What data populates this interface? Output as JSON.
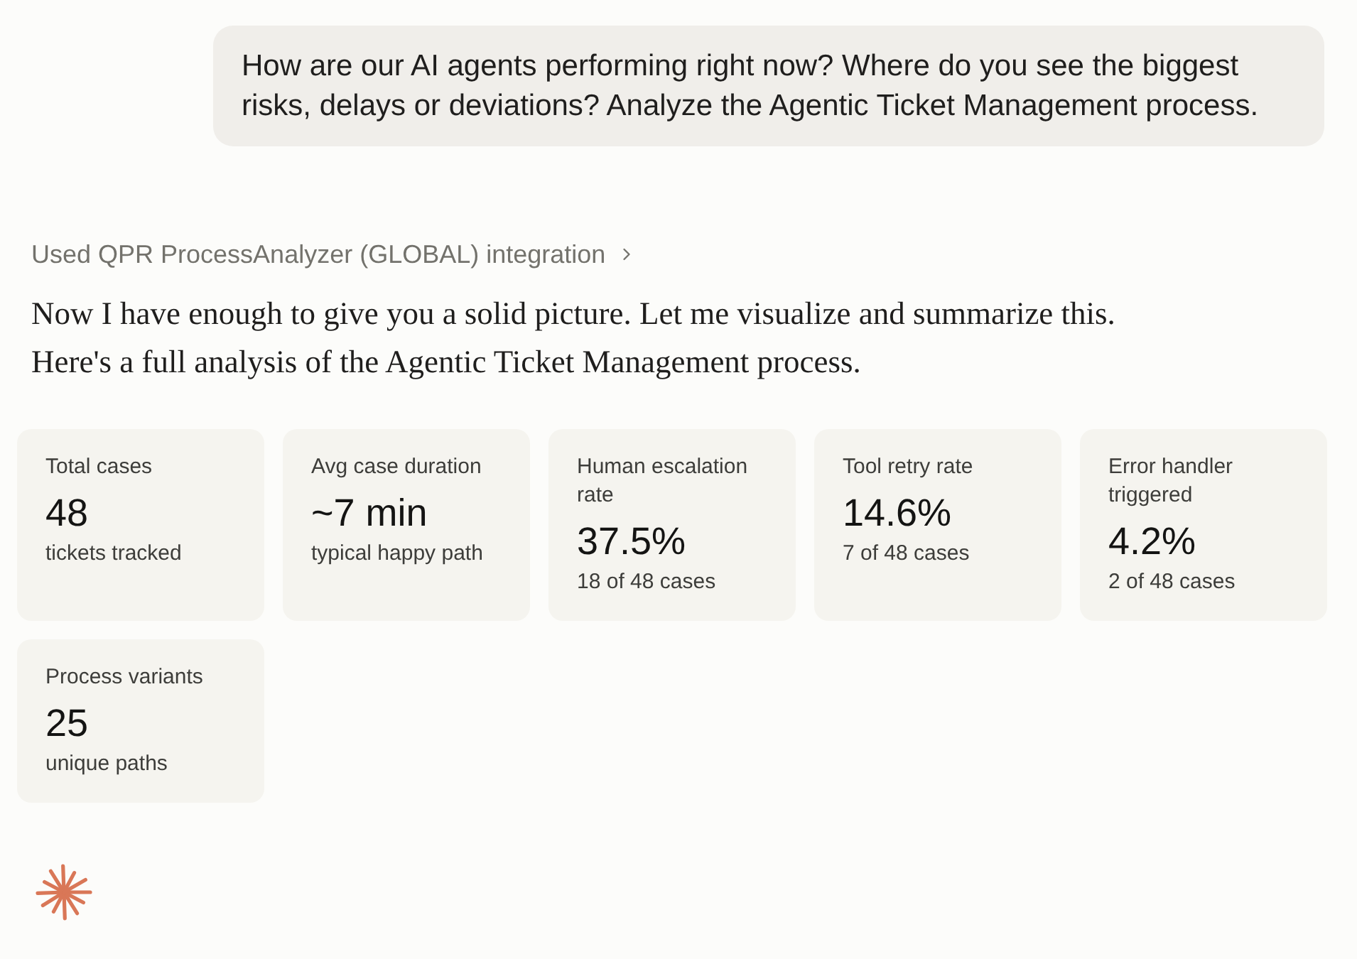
{
  "user_message": {
    "text": "How are our AI agents performing right now? Where do you see the biggest risks, delays or deviations? Analyze the Agentic Ticket Management process."
  },
  "tool_use": {
    "label": "Used QPR ProcessAnalyzer (GLOBAL) integration",
    "expanded": false
  },
  "response": {
    "paragraphs": [
      "Now I have enough to give you a solid picture. Let me visualize and summarize this.",
      "Here's a full analysis of the Agentic Ticket Management process."
    ]
  },
  "metrics": [
    {
      "label": "Total cases",
      "value": "48",
      "caption": "tickets tracked"
    },
    {
      "label": "Avg case duration",
      "value": "~7 min",
      "caption": "typical happy path"
    },
    {
      "label": "Human escalation rate",
      "value": "37.5%",
      "caption": "18 of 48 cases"
    },
    {
      "label": "Tool retry rate",
      "value": "14.6%",
      "caption": "7 of 48 cases"
    },
    {
      "label": "Error handler triggered",
      "value": "4.2%",
      "caption": "2 of 48 cases"
    },
    {
      "label": "Process variants",
      "value": "25",
      "caption": "unique paths"
    }
  ]
}
